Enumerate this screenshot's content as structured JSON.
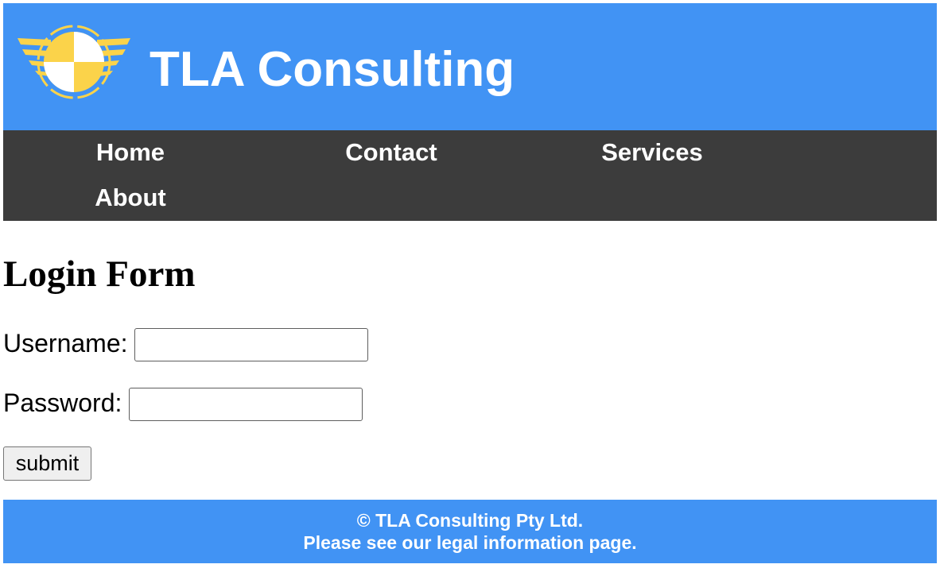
{
  "header": {
    "title": "TLA Consulting",
    "logo_icon": "winged-roundel-logo-icon"
  },
  "nav": {
    "items": [
      {
        "label": "Home"
      },
      {
        "label": "Contact"
      },
      {
        "label": "Services"
      },
      {
        "label": "About"
      }
    ]
  },
  "form": {
    "title": "Login Form",
    "username_label": "Username:",
    "username_value": "",
    "password_label": "Password:",
    "password_value": "",
    "submit_label": "submit"
  },
  "footer": {
    "copyright": "© TLA Consulting Pty Ltd.",
    "legal": "Please see our legal information page."
  },
  "colors": {
    "header_background": "#4193f4",
    "nav_background": "#3c3c3c",
    "logo_yellow": "#fbd34a",
    "footer_background": "#4193f4"
  }
}
